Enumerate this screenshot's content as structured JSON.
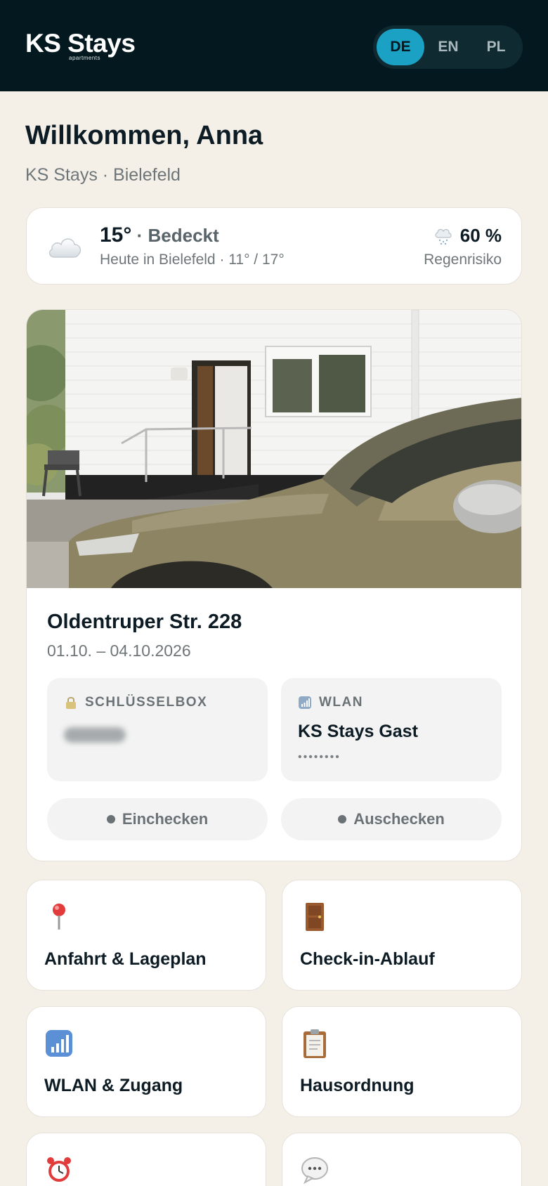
{
  "header": {
    "brand_name": "KS Stays",
    "brand_sub": "apartments",
    "languages": [
      {
        "code": "DE",
        "active": true
      },
      {
        "code": "EN",
        "active": false
      },
      {
        "code": "PL",
        "active": false
      }
    ]
  },
  "welcome": {
    "title": "Willkommen, Anna",
    "subtitle": "KS Stays · Bielefeld"
  },
  "weather": {
    "icon": "cloud-icon",
    "temperature": "15°",
    "condition": "· Bedeckt",
    "detail": "Heute in Bielefeld · 11° / 17°",
    "rain_icon": "rain-cloud-icon",
    "rain_percent": "60 %",
    "rain_label": "Regenrisiko"
  },
  "apartment": {
    "address": "Oldentruper Str. 228",
    "dates": "01.10. – 04.10.2026",
    "keybox": {
      "icon": "lock-icon",
      "label": "SCHLÜSSELBOX"
    },
    "wifi": {
      "icon": "signal-icon",
      "label": "WLAN",
      "network": "KS Stays Gast",
      "password_mask": "••••••••"
    },
    "checkin_label": "Einchecken",
    "checkout_label": "Auschecken"
  },
  "tiles": [
    {
      "icon": "pin-icon",
      "label": "Anfahrt & Lageplan"
    },
    {
      "icon": "door-icon",
      "label": "Check-in-Ablauf"
    },
    {
      "icon": "signal-icon",
      "label": "WLAN & Zugang"
    },
    {
      "icon": "clipboard-icon",
      "label": "Hausordnung"
    },
    {
      "icon": "alarm-clock-icon",
      "label": ""
    },
    {
      "icon": "speech-bubble-icon",
      "label": ""
    }
  ],
  "colors": {
    "header_bg": "#04191f",
    "accent": "#1aa1c4",
    "page_bg": "#f4f0e8"
  }
}
